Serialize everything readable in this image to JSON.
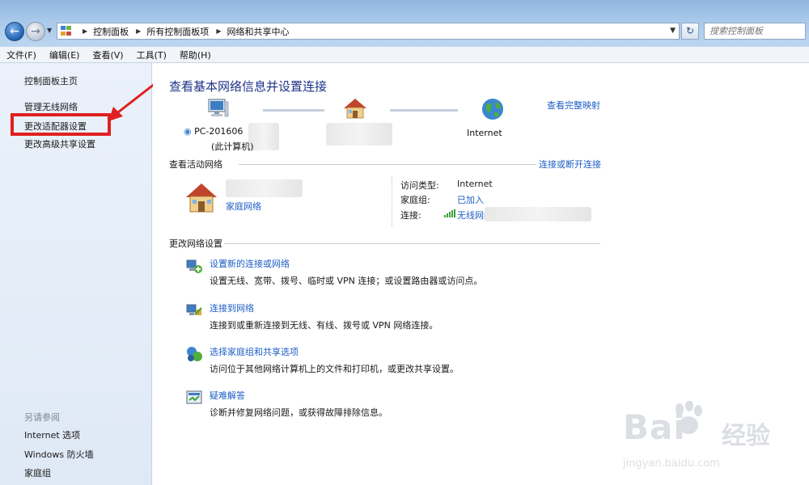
{
  "addressbar": {
    "crumbs": [
      "控制面板",
      "所有控制面板项",
      "网络和共享中心"
    ],
    "search_placeholder": "搜索控制面板"
  },
  "menu": [
    "文件(F)",
    "编辑(E)",
    "查看(V)",
    "工具(T)",
    "帮助(H)"
  ],
  "sidebar": {
    "home": "控制面板主页",
    "items": [
      "管理无线网络",
      "更改适配器设置",
      "更改高级共享设置"
    ],
    "see_also_title": "另请参阅",
    "see_also": [
      "Internet 选项",
      "Windows 防火墙",
      "家庭组"
    ]
  },
  "main": {
    "title": "查看基本网络信息并设置连接",
    "map": {
      "pc_name": "PC-201606",
      "pc_sub": "(此计算机)",
      "internet": "Internet",
      "view_full_map": "查看完整映射"
    },
    "active": {
      "heading": "查看活动网络",
      "connect_link": "连接或断开连接",
      "network_type": "家庭网络",
      "access_type_label": "访问类型:",
      "access_type_value": "Internet",
      "homegroup_label": "家庭组:",
      "homegroup_value": "已加入",
      "connection_label": "连接:",
      "connection_value": "无线网络"
    },
    "change": {
      "heading": "更改网络设置",
      "tasks": [
        {
          "link": "设置新的连接或网络",
          "desc": "设置无线、宽带、拨号、临时或 VPN 连接；或设置路由器或访问点。"
        },
        {
          "link": "连接到网络",
          "desc": "连接到或重新连接到无线、有线、拨号或 VPN 网络连接。"
        },
        {
          "link": "选择家庭组和共享选项",
          "desc": "访问位于其他网络计算机上的文件和打印机，或更改共享设置。"
        },
        {
          "link": "疑难解答",
          "desc": "诊断并修复网络问题，或获得故障排除信息。"
        }
      ]
    }
  },
  "watermark": {
    "brand": "Bai",
    "cn": "经验",
    "url": "jingyan.baidu.com"
  },
  "colors": {
    "link": "#1d5ec5",
    "title": "#1e3287",
    "highlight": "#e02020"
  }
}
